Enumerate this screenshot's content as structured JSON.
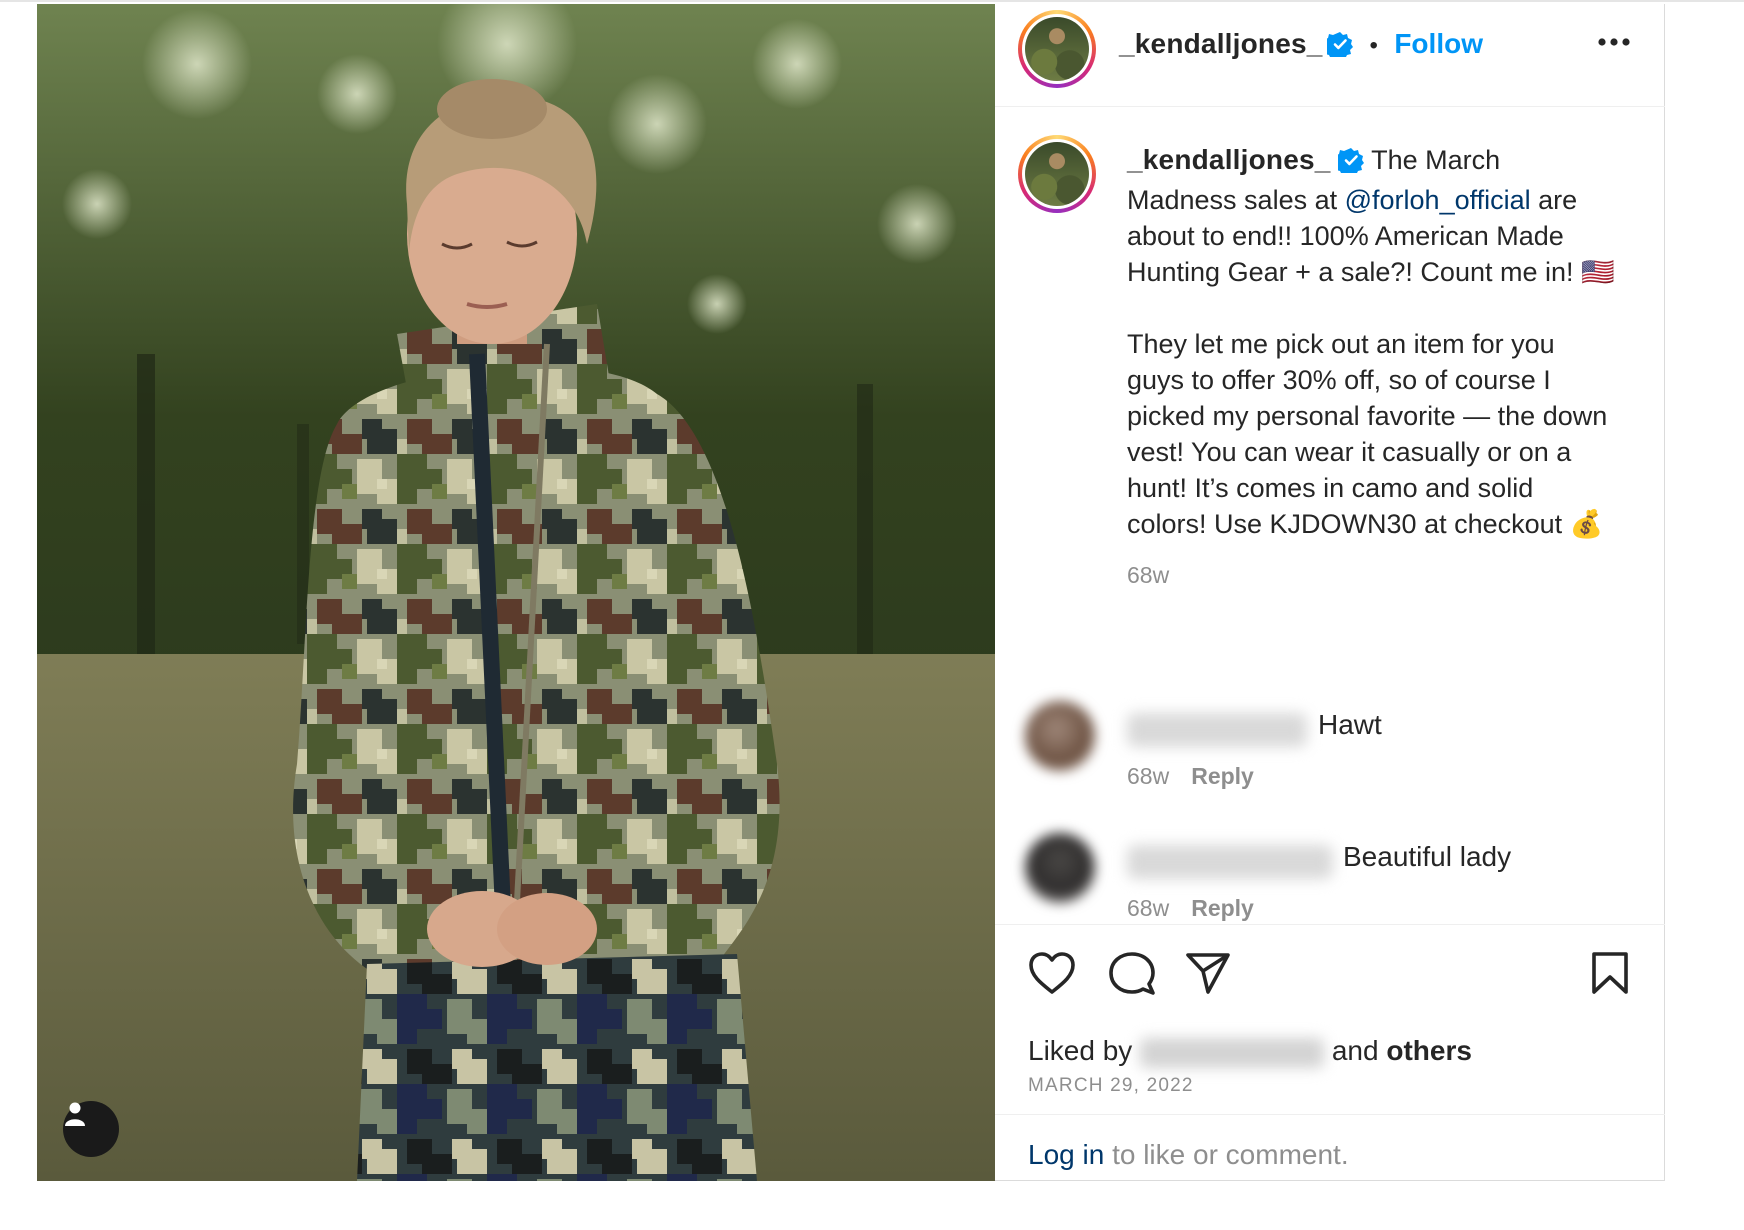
{
  "post": {
    "author": "_kendalljones_",
    "separator": "•",
    "follow_label": "Follow",
    "caption": {
      "intro": "The March Madness sales at",
      "mention": "@forloh_official",
      "rest": "are about to end!! 100% American Made Hunting Gear + a sale?! Count me in! 🇺🇸",
      "paragraph2": "They let me pick out an item for you guys to offer 30% off, so of course I picked my personal favorite — the down vest! You can wear it casually or on a hunt! It’s comes in camo and solid colors! Use KJDOWN30 at checkout 💰",
      "age": "68w"
    },
    "comments": [
      {
        "text": "Hawt",
        "age": "68w",
        "reply_label": "Reply"
      },
      {
        "text": "Beautiful lady",
        "age": "68w",
        "reply_label": "Reply"
      }
    ],
    "likes": {
      "prefix": "Liked by",
      "middle": "and",
      "others": "others"
    },
    "date": "MARCH 29, 2022",
    "login": {
      "link": "Log in",
      "text": "to like or comment."
    }
  },
  "icons": {
    "verified": "verified-badge-icon",
    "more": "more-options-icon",
    "like": "heart-icon",
    "comment": "comment-icon",
    "share": "send-icon",
    "save": "bookmark-icon",
    "tagged": "user-tag-icon"
  },
  "colors": {
    "accent": "#0095f6",
    "mention": "#00376b",
    "muted": "#8e8e8e",
    "text": "#262626"
  }
}
